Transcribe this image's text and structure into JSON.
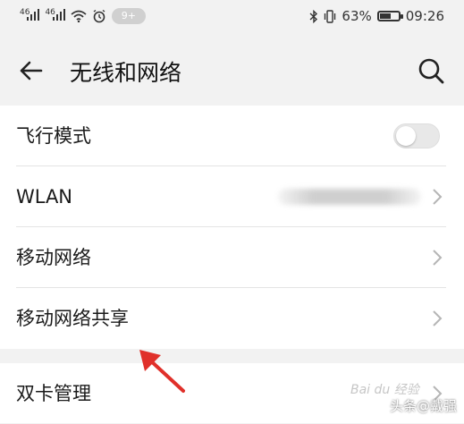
{
  "status_bar": {
    "signal1": "46",
    "signal2": "46",
    "notif_badge": "9+",
    "battery": "63%",
    "battery_level": 0.63,
    "time": "09:26"
  },
  "app_bar": {
    "title": "无线和网络"
  },
  "settings": {
    "items": [
      {
        "label": "飞行模式",
        "control": "toggle",
        "on": false
      },
      {
        "label": "WLAN",
        "control": "chevron"
      },
      {
        "label": "移动网络",
        "control": "chevron"
      },
      {
        "label": "移动网络共享",
        "control": "chevron"
      }
    ],
    "section2": [
      {
        "label": "双卡管理",
        "control": "chevron"
      }
    ]
  },
  "overlay": {
    "arrow_color": "#e0302a",
    "watermark": "头条@戴强",
    "baidu_mark": "Bai du 经验"
  },
  "colors": {
    "background": "#f2f2f2",
    "surface": "#ffffff",
    "text": "#1a1a1a"
  }
}
